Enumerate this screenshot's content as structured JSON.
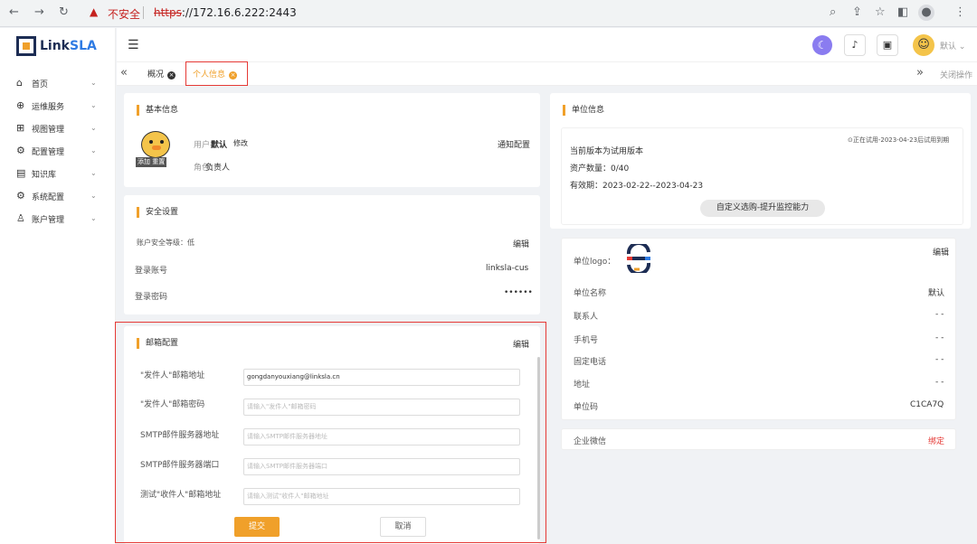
{
  "browser": {
    "warning_label": "不安全",
    "url_scheme": "https",
    "url_rest": "://172.16.6.222:2443"
  },
  "app": {
    "logo_main": "Link",
    "logo_accent": "SLA",
    "logo_initial": "L"
  },
  "sidebar": {
    "items": [
      {
        "icon": "home-icon",
        "label": "首页"
      },
      {
        "icon": "globe-icon",
        "label": "运维服务"
      },
      {
        "icon": "dashboard-icon",
        "label": "视图管理"
      },
      {
        "icon": "config-icon",
        "label": "配置管理"
      },
      {
        "icon": "knowledge-icon",
        "label": "知识库"
      },
      {
        "icon": "gear-icon",
        "label": "系统配置"
      },
      {
        "icon": "user-icon",
        "label": "账户管理"
      }
    ]
  },
  "header": {
    "user_name": "默认"
  },
  "tabs": {
    "overview": "概况",
    "personal": "个人信息",
    "close_ops": "关闭操作"
  },
  "basic_info": {
    "title": "基本信息",
    "username_label": "用户名：",
    "username": "默认",
    "edit_link": "修改",
    "role_label": "角色：",
    "role": "负责人",
    "notify_link": "通知配置",
    "avatar_tag": "添加  重置"
  },
  "security": {
    "title": "安全设置",
    "level_label": "账户安全等级：",
    "level": "低",
    "edit_link": "编辑",
    "account_label": "登录账号",
    "account_value": "linksla-cus",
    "password_label": "登录密码",
    "password_value": "••••••"
  },
  "email_config": {
    "title": "邮箱配置",
    "edit_link": "编辑",
    "fields": [
      {
        "label": "\"发件人\"邮箱地址",
        "value": "gongdanyouxiang@linksla.cn",
        "placeholder": ""
      },
      {
        "label": "\"发件人\"邮箱密码",
        "value": "",
        "placeholder": "请输入\"发件人\"邮箱密码"
      },
      {
        "label": "SMTP邮件服务器地址",
        "value": "",
        "placeholder": "请输入SMTP邮件服务器地址"
      },
      {
        "label": "SMTP邮件服务器端口",
        "value": "",
        "placeholder": "请输入SMTP邮件服务器端口"
      },
      {
        "label": "测试\"收件人\"邮箱地址",
        "value": "",
        "placeholder": "请输入测试\"收件人\"邮箱地址"
      }
    ],
    "submit": "提交",
    "cancel": "取消"
  },
  "unit_info": {
    "title": "单位信息",
    "trial_notice": "⊙正在试用-2023-04-23后试用到期",
    "version": "当前版本为试用版本",
    "asset_count": "资产数量：0/40",
    "validity": "有效期：2023-02-22--2023-04-23",
    "trial_button": "自定义选购-提升监控能力"
  },
  "unit_details": {
    "edit_link": "编辑",
    "logo_label": "单位logo：",
    "rows": [
      {
        "label": "单位名称",
        "value": "默认"
      },
      {
        "label": "联系人",
        "value": "- -"
      },
      {
        "label": "手机号",
        "value": "- -"
      },
      {
        "label": "固定电话",
        "value": "- -"
      },
      {
        "label": "地址",
        "value": "- -"
      },
      {
        "label": "单位码",
        "value": "C1CA7Q"
      }
    ]
  },
  "wecom": {
    "label": "企业微信",
    "bind_link": "绑定"
  }
}
